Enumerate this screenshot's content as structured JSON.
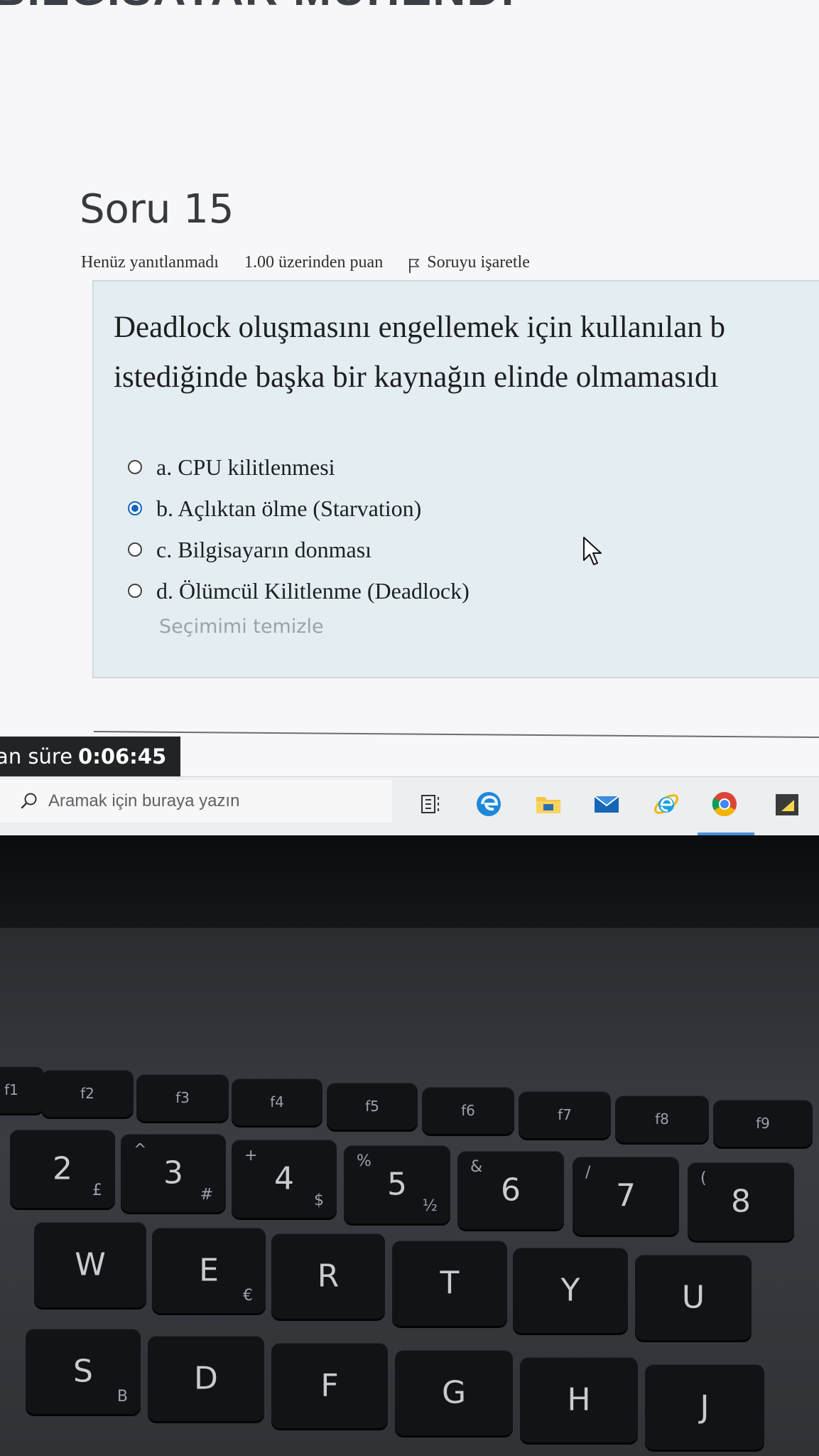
{
  "site": {
    "banner": "BİLGİSAYAR MÜHENDİ"
  },
  "question": {
    "title": "Soru 15",
    "status": "Henüz yanıtlanmadı",
    "points": "1.00 üzerinden puan",
    "flag_label": "Soruyu işaretle",
    "text_line1": "Deadlock oluşmasını engellemek için kullanılan b",
    "text_line2": "istediğinde başka bir kaynağın elinde olmamasıdı",
    "answers": [
      {
        "label": "a. CPU kilitlenmesi",
        "selected": false
      },
      {
        "label": "b. Açlıktan ölme (Starvation)",
        "selected": true
      },
      {
        "label": "c. Bilgisayarın donması",
        "selected": false
      },
      {
        "label": "d. Ölümcül Kilitlenme (Deadlock)",
        "selected": false
      }
    ],
    "clear_choice": "Seçimimi temizle"
  },
  "timer": {
    "label": "lan süre",
    "value": "0:06:45"
  },
  "taskbar": {
    "search_placeholder": "Aramak için buraya yazın",
    "icons": [
      "task-view-icon",
      "edge-icon",
      "file-explorer-icon",
      "mail-icon",
      "internet-explorer-icon",
      "chrome-icon",
      "sticky-notes-icon"
    ]
  },
  "keyboard": {
    "fkeys": [
      "f1",
      "f2",
      "f3",
      "f4",
      "f5",
      "f6",
      "f7",
      "f8",
      "f9"
    ],
    "numbers": [
      {
        "main": "2",
        "sub": "£"
      },
      {
        "main": "3",
        "sub": "#",
        "top": "^"
      },
      {
        "main": "4",
        "sub": "$",
        "top": "+"
      },
      {
        "main": "5",
        "sub": "½",
        "top": "%"
      },
      {
        "main": "6",
        "top": "&"
      },
      {
        "main": "7",
        "top": "/"
      },
      {
        "main": "8",
        "top": "("
      }
    ],
    "row_q": [
      "W",
      "E",
      "R",
      "T",
      "Y",
      "U"
    ],
    "row_q_sub": {
      "E": "€"
    },
    "row_a": [
      "S",
      "D",
      "F",
      "G",
      "H",
      "J"
    ],
    "row_a_sub": {
      "S": "B"
    }
  },
  "colors": {
    "accent": "#1565c0",
    "question_bg": "#e4eef2",
    "timer_bg": "#212325"
  }
}
